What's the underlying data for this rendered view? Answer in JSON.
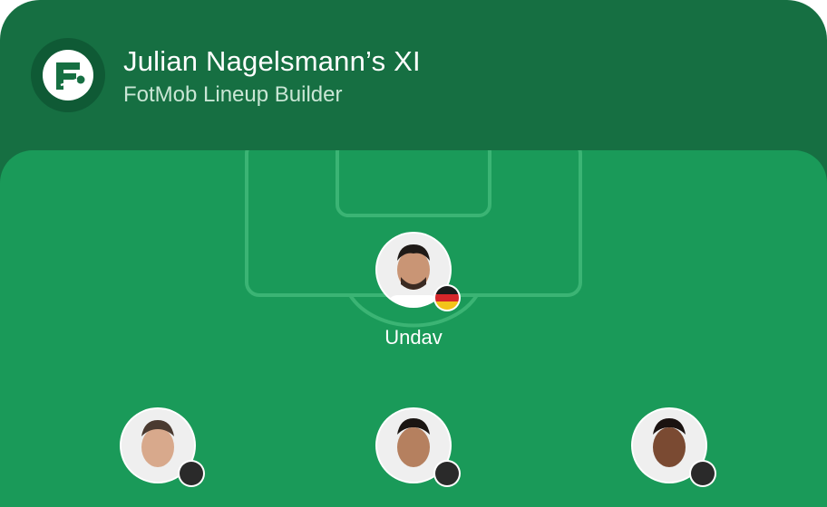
{
  "header": {
    "title": "Julian Nagelsmann’s XI",
    "subtitle": "FotMob Lineup Builder",
    "logo_icon": "fotmob-logo-icon"
  },
  "colors": {
    "header_bg": "#166f42",
    "pitch_bg": "#1a9a59",
    "pitch_lines": "#3bb474",
    "subtitle": "#c9e6d5"
  },
  "players": [
    {
      "name": "Undav",
      "flag": "germany-flag-icon",
      "flag_colors": [
        "#1b1b1b",
        "#d6262a",
        "#f3c41a"
      ]
    },
    {
      "name": "",
      "flag": "flag-icon"
    },
    {
      "name": "",
      "flag": "flag-icon"
    },
    {
      "name": "",
      "flag": "flag-icon"
    }
  ]
}
